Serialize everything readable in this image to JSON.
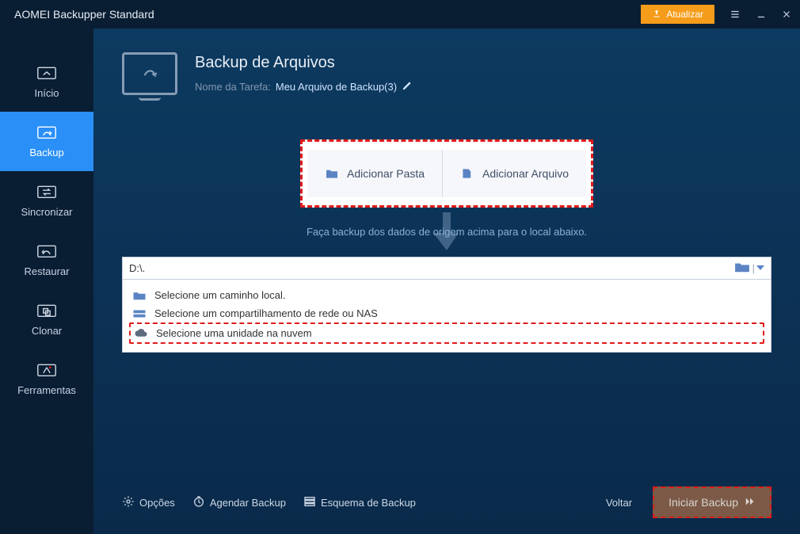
{
  "app": {
    "title": "AOMEI Backupper Standard",
    "upgrade": "Atualizar"
  },
  "sidebar": {
    "items": [
      {
        "label": "Início"
      },
      {
        "label": "Backup"
      },
      {
        "label": "Sincronizar"
      },
      {
        "label": "Restaurar"
      },
      {
        "label": "Clonar"
      },
      {
        "label": "Ferramentas"
      }
    ]
  },
  "page": {
    "title": "Backup de Arquivos",
    "task_label": "Nome da Tarefa:",
    "task_name": "Meu Arquivo de Backup(3)"
  },
  "add": {
    "folder": "Adicionar Pasta",
    "file": "Adicionar Arquivo",
    "hint": "Faça backup dos dados de origem acima para o local abaixo."
  },
  "dest": {
    "path": "D:\\.",
    "options": [
      "Selecione um caminho local.",
      "Selecione um compartilhamento de rede ou NAS",
      "Selecione uma unidade na nuvem"
    ]
  },
  "footer": {
    "options": "Opções",
    "schedule": "Agendar Backup",
    "scheme": "Esquema de Backup",
    "back": "Voltar",
    "start": "Iniciar Backup"
  }
}
